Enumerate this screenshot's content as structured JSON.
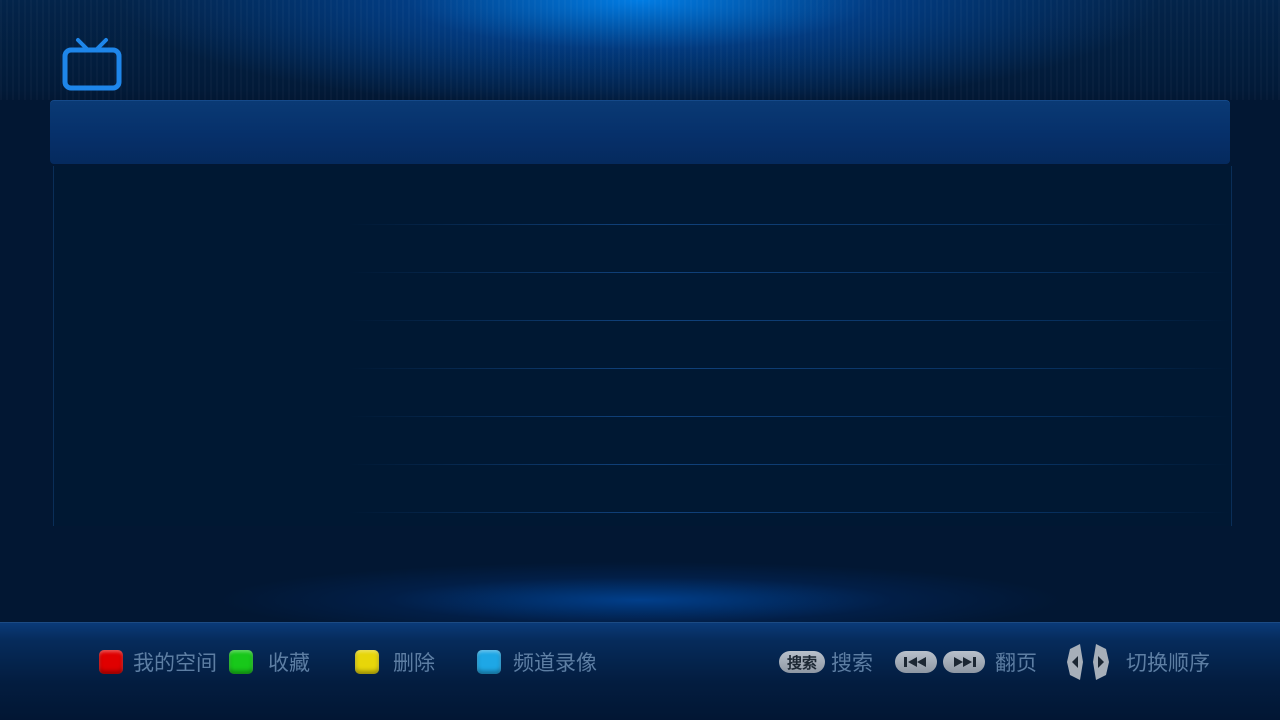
{
  "header": {
    "logo_icon": "tv-icon",
    "title": ""
  },
  "footer": {
    "red_label": "我的空间",
    "green_label": "收藏",
    "yellow_label": "删除",
    "blue_label": "频道录像",
    "search_key_label": "搜索",
    "search_label": "搜索",
    "page_label": "翻页",
    "order_label": "切换顺序"
  },
  "colors": {
    "red_key": "#e00000",
    "green_key": "#18c81a",
    "yellow_key": "#e7d60a",
    "blue_key": "#1ea7e6",
    "accent": "#1e86ea"
  },
  "icons": {
    "search_key": "search-key-icon",
    "rewind_key": "rewind-key-icon",
    "forward_key": "fast-forward-key-icon",
    "left_key": "left-arrow-key-icon",
    "right_key": "right-arrow-key-icon"
  }
}
